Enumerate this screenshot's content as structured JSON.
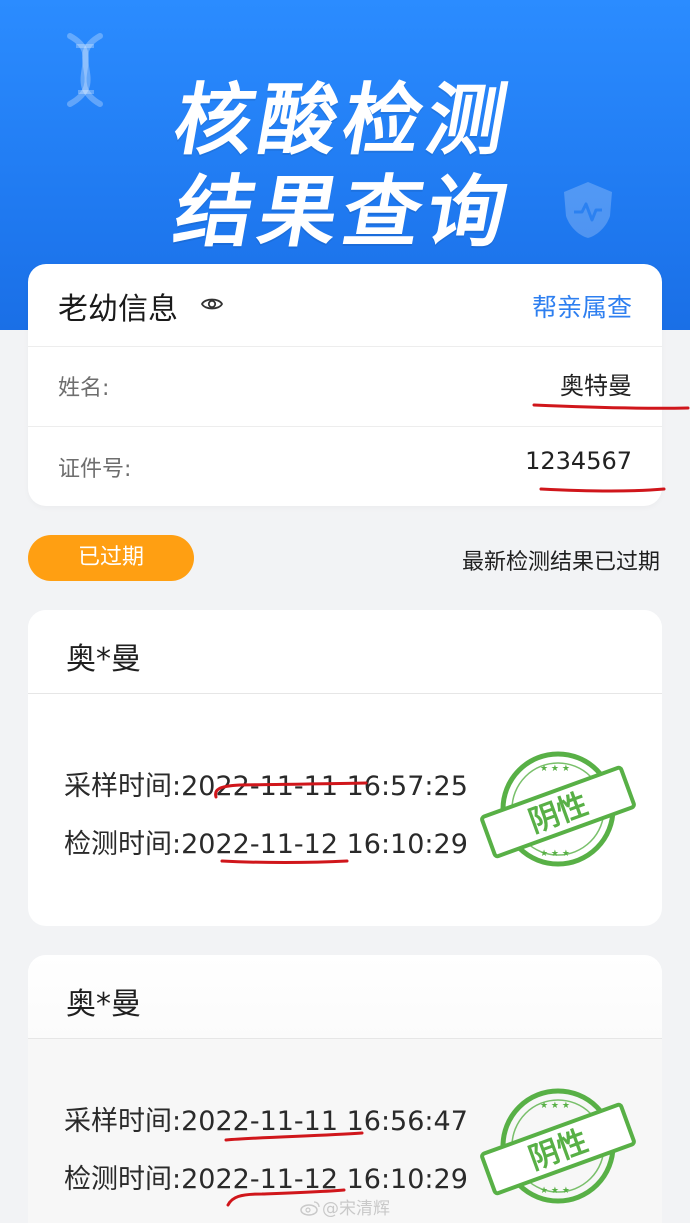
{
  "hero": {
    "title_line1": "核酸检测",
    "title_line2": "结果查询"
  },
  "info_card": {
    "title": "老幼信息",
    "family_query_label": "帮亲属查",
    "name_label": "姓名:",
    "name_value": "奥特曼",
    "id_label": "证件号:",
    "id_value": "1234567"
  },
  "status": {
    "badge_label": "已过期",
    "message": "最新检测结果已过期"
  },
  "results": [
    {
      "name": "奥*曼",
      "sampling_label": "采样时间:",
      "sampling_time": "2022-11-11 16:57:25",
      "testing_label": "检测时间:",
      "testing_time": "2022-11-12 16:10:29",
      "stamp_text": "阴性"
    },
    {
      "name": "奥*曼",
      "sampling_label": "采样时间:",
      "sampling_time": "2022-11-11 16:56:47",
      "testing_label": "检测时间:",
      "testing_time": "2022-11-12 16:10:29",
      "stamp_text": "阴性"
    }
  ],
  "watermark": "@宋清辉",
  "colors": {
    "hero_blue": "#1f79f0",
    "link_blue": "#2e7ff0",
    "badge_orange": "#ff9f12",
    "stamp_green": "#58b046",
    "annotation_red": "#d0161b"
  },
  "icons": [
    "dna-icon",
    "eye-icon",
    "shield-icon",
    "weibo-icon"
  ]
}
